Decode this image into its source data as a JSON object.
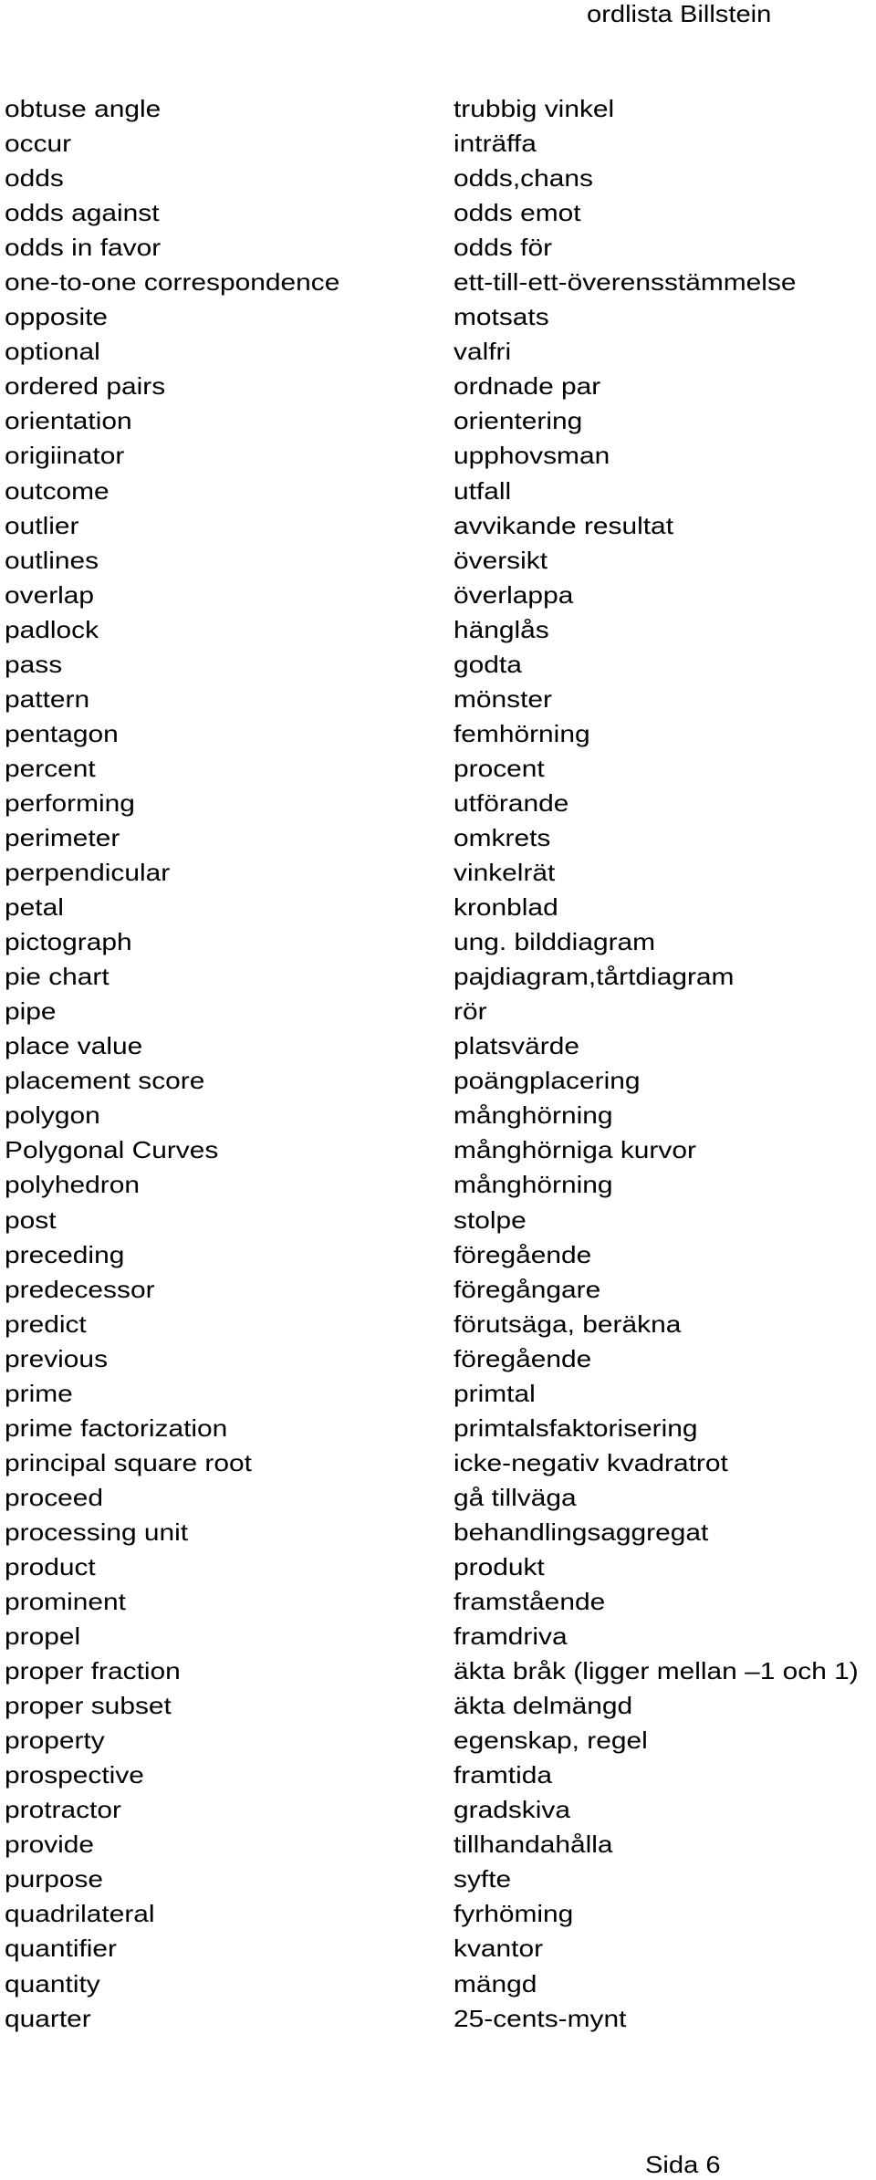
{
  "header": {
    "title": "ordlista Billstein"
  },
  "entries": [
    {
      "en": "obtuse angle",
      "sv": "trubbig vinkel"
    },
    {
      "en": "occur",
      "sv": "inträffa"
    },
    {
      "en": "odds",
      "sv": "odds,chans"
    },
    {
      "en": "odds against",
      "sv": "odds emot"
    },
    {
      "en": "odds in favor",
      "sv": "odds för"
    },
    {
      "en": "one-to-one correspondence",
      "sv": "ett-till-ett-överensstämmelse"
    },
    {
      "en": "opposite",
      "sv": "motsats"
    },
    {
      "en": "optional",
      "sv": "valfri"
    },
    {
      "en": "ordered pairs",
      "sv": "ordnade par"
    },
    {
      "en": "orientation",
      "sv": "orientering"
    },
    {
      "en": "origiinator",
      "sv": "upphovsman"
    },
    {
      "en": "outcome",
      "sv": "utfall"
    },
    {
      "en": "outlier",
      "sv": "avvikande resultat"
    },
    {
      "en": "outlines",
      "sv": "översikt"
    },
    {
      "en": "overlap",
      "sv": "överlappa"
    },
    {
      "en": "padlock",
      "sv": "hänglås"
    },
    {
      "en": "pass",
      "sv": "godta"
    },
    {
      "en": "pattern",
      "sv": "mönster"
    },
    {
      "en": "pentagon",
      "sv": "femhörning"
    },
    {
      "en": "percent",
      "sv": "procent"
    },
    {
      "en": "performing",
      "sv": "utförande"
    },
    {
      "en": "perimeter",
      "sv": "omkrets"
    },
    {
      "en": "perpendicular",
      "sv": "vinkelrät"
    },
    {
      "en": "petal",
      "sv": "kronblad"
    },
    {
      "en": "pictograph",
      "sv": "ung. bilddiagram"
    },
    {
      "en": "pie chart",
      "sv": "pajdiagram,tårtdiagram"
    },
    {
      "en": "pipe",
      "sv": "rör"
    },
    {
      "en": "place value",
      "sv": "platsvärde"
    },
    {
      "en": "placement score",
      "sv": "poängplacering"
    },
    {
      "en": "polygon",
      "sv": "månghörning"
    },
    {
      "en": "Polygonal Curves",
      "sv": "månghörniga kurvor"
    },
    {
      "en": "polyhedron",
      "sv": "månghörning"
    },
    {
      "en": "post",
      "sv": "stolpe"
    },
    {
      "en": "preceding",
      "sv": "föregående"
    },
    {
      "en": "predecessor",
      "sv": "föregångare"
    },
    {
      "en": "predict",
      "sv": "förutsäga, beräkna"
    },
    {
      "en": "previous",
      "sv": "föregående"
    },
    {
      "en": "prime",
      "sv": "primtal"
    },
    {
      "en": "prime factorization",
      "sv": "primtalsfaktorisering"
    },
    {
      "en": "principal square root",
      "sv": "icke-negativ kvadratrot"
    },
    {
      "en": "proceed",
      "sv": "gå tillväga"
    },
    {
      "en": "processing unit",
      "sv": "behandlingsaggregat"
    },
    {
      "en": "product",
      "sv": "produkt"
    },
    {
      "en": "prominent",
      "sv": "framstående"
    },
    {
      "en": "propel",
      "sv": "framdriva"
    },
    {
      "en": "proper fraction",
      "sv": "äkta bråk (ligger mellan –1 och 1)"
    },
    {
      "en": "proper subset",
      "sv": "äkta delmängd"
    },
    {
      "en": "property",
      "sv": "egenskap, regel"
    },
    {
      "en": "prospective",
      "sv": "framtida"
    },
    {
      "en": "protractor",
      "sv": "gradskiva"
    },
    {
      "en": "provide",
      "sv": "tillhandahålla"
    },
    {
      "en": "purpose",
      "sv": "syfte"
    },
    {
      "en": "quadrilateral",
      "sv": "fyrhöming"
    },
    {
      "en": "quantifier",
      "sv": "kvantor"
    },
    {
      "en": "quantity",
      "sv": "mängd"
    },
    {
      "en": "quarter",
      "sv": "25-cents-mynt"
    }
  ],
  "footer": {
    "page": "Sida 6"
  }
}
